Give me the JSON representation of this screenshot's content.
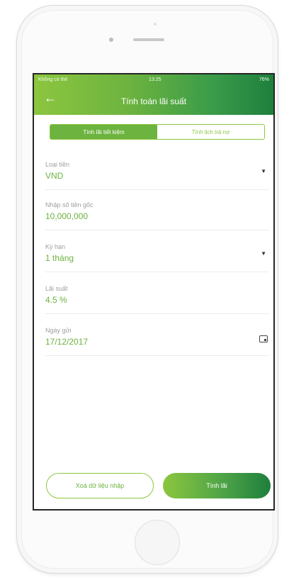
{
  "status_bar": {
    "carrier": "Không có thẻ",
    "time": "13:25",
    "battery": "76%"
  },
  "header": {
    "title": "Tính toán lãi suất",
    "back_icon": "arrow-left-icon"
  },
  "tabs": [
    {
      "label": "Tính lãi tiết kiệm",
      "active": true
    },
    {
      "label": "Tính lịch trả nợ",
      "active": false
    }
  ],
  "form": {
    "currency": {
      "label": "Loại tiền",
      "value": "VND"
    },
    "principal": {
      "label": "Nhập số tiền gốc",
      "value": "10,000,000"
    },
    "term": {
      "label": "Kỳ hạn",
      "value": "1 tháng"
    },
    "rate": {
      "label": "Lãi suất",
      "value": "4.5 %"
    },
    "deposit_date": {
      "label": "Ngày gửi",
      "value": "17/12/2017"
    }
  },
  "buttons": {
    "clear": "Xoá dữ liệu nhập",
    "calculate": "Tính lãi"
  },
  "colors": {
    "accent": "#6cb33f",
    "dark_green": "#1e7f3c",
    "light_green": "#8cc63f"
  }
}
